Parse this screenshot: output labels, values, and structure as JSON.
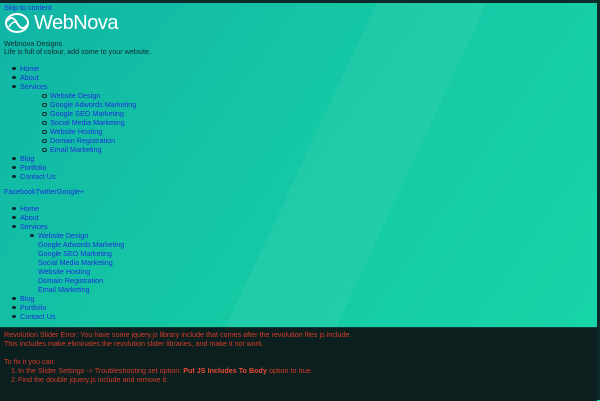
{
  "colors": {
    "background": "#17c9a0",
    "link": "#1c2fd8",
    "error_text": "#d83c2a",
    "error_bg": "#0a1f1e"
  },
  "skip_link": "Skip to content",
  "logo": {
    "text": "WebNova",
    "icon": "webnova-swirl-icon"
  },
  "site": {
    "name": "Webnova Designs",
    "tagline": "Life is full of colour, add some to your website."
  },
  "menu": {
    "items": [
      "Home",
      "About",
      "Services",
      "Blog",
      "Portfolio",
      "Contact Us"
    ],
    "services_sub": [
      "Website Design",
      "Google Adwords Marketing",
      "Google SEO Marketing",
      "Social Media Marketing",
      "Website Hosting",
      "Domain Registration",
      "Email Marketing"
    ]
  },
  "social": {
    "facebook": "Facebook",
    "twitter": "Twitter",
    "googleplus": "Google+"
  },
  "error": {
    "line1": "Revolution Slider Error: You have some jquery.js library include that comes after the revolution files js include.",
    "line2": "This includes make eliminates the revolution slider libraries, and make it not work.",
    "line3": "To fix it you can:",
    "step1_prefix": "In the Slider Settings -> Troubleshooting set option:",
    "step1_bold": "Put JS Includes To Body",
    "step1_suffix": "option to true.",
    "step2": "Find the double jquery.js include and remove it.",
    "num1": "1.",
    "num2": "2."
  }
}
